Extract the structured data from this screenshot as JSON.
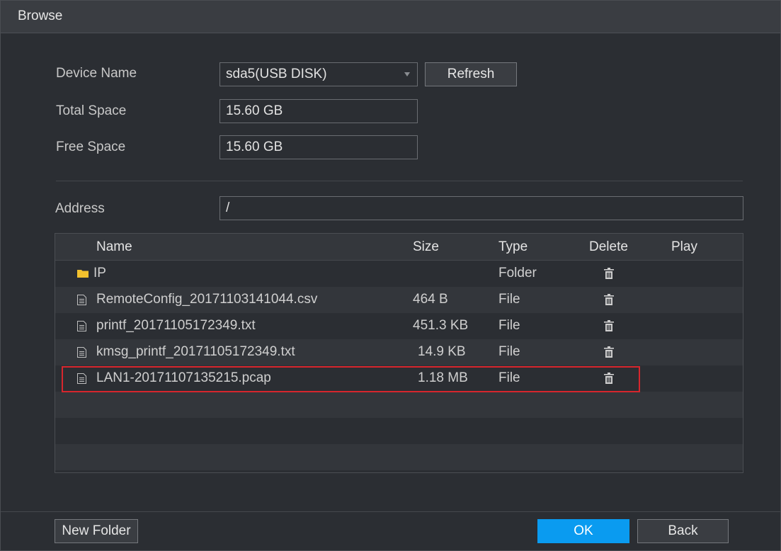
{
  "window": {
    "title": "Browse"
  },
  "form": {
    "device_name_label": "Device Name",
    "device_name_value": "sda5(USB DISK)",
    "refresh_label": "Refresh",
    "total_space_label": "Total Space",
    "total_space_value": "15.60 GB",
    "free_space_label": "Free Space",
    "free_space_value": "15.60 GB",
    "address_label": "Address",
    "address_value": "/"
  },
  "table": {
    "headers": {
      "name": "Name",
      "size": "Size",
      "type": "Type",
      "delete": "Delete",
      "play": "Play"
    },
    "rows": [
      {
        "icon": "folder-icon",
        "name": "IP",
        "size": "",
        "type": "Folder"
      },
      {
        "icon": "file-icon",
        "name": "RemoteConfig_20171103141044.csv",
        "size": "464 B",
        "type": "File"
      },
      {
        "icon": "file-icon",
        "name": "printf_20171105172349.txt",
        "size": "451.3 KB",
        "type": "File"
      },
      {
        "icon": "file-icon",
        "name": "kmsg_printf_20171105172349.txt",
        "size": "14.9 KB",
        "type": "File"
      },
      {
        "icon": "file-icon",
        "name": "LAN1-20171107135215.pcap",
        "size": "1.18 MB",
        "type": "File"
      }
    ]
  },
  "footer": {
    "new_folder_label": "New Folder",
    "ok_label": "OK",
    "back_label": "Back"
  },
  "colors": {
    "background": "#2b2e33",
    "accent": "#0a9bf0",
    "highlight": "#d7262d",
    "folder": "#f2c12e"
  }
}
